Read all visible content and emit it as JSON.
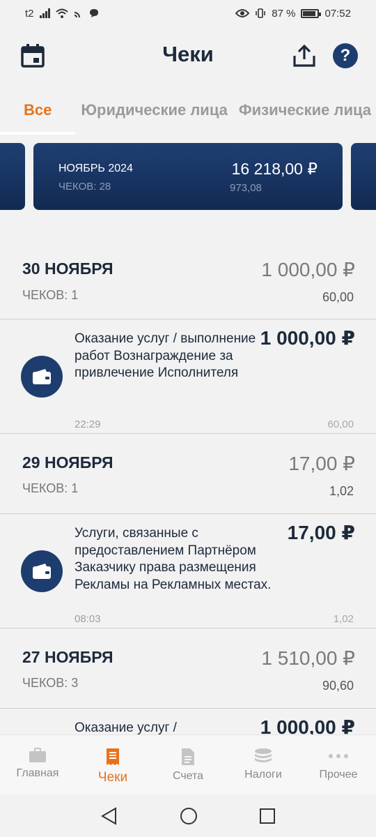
{
  "status_bar": {
    "carrier": "t2",
    "battery": "87 %",
    "time": "07:52"
  },
  "header": {
    "title": "Чеки"
  },
  "tabs": [
    {
      "label": "Все",
      "active": true
    },
    {
      "label": "Юридические лица",
      "active": false
    },
    {
      "label": "Физические лица",
      "active": false
    }
  ],
  "month_card": {
    "month": "НОЯБРЬ 2024",
    "count": "ЧЕКОВ: 28",
    "sum": "16 218,00 ₽",
    "tax": "973,08"
  },
  "days": [
    {
      "date": "30 НОЯБРЯ",
      "count": "ЧЕКОВ: 1",
      "amount": "1 000,00 ₽",
      "tax": "60,00",
      "receipts": [
        {
          "description": "Оказание услуг / выполнение работ Вознаграждение за привлечение Исполнителя",
          "time": "22:29",
          "amount": "1 000,00 ₽",
          "tax": "60,00"
        }
      ]
    },
    {
      "date": "29 НОЯБРЯ",
      "count": "ЧЕКОВ: 1",
      "amount": "17,00 ₽",
      "tax": "1,02",
      "receipts": [
        {
          "description": "Услуги, связанные с предоставлением Партнёром Заказчику права размещения Рекламы на Рекламных местах.",
          "time": "08:03",
          "amount": "17,00 ₽",
          "tax": "1,02"
        }
      ]
    },
    {
      "date": "27 НОЯБРЯ",
      "count": "ЧЕКОВ: 3",
      "amount": "1 510,00 ₽",
      "tax": "90,60",
      "receipts": [
        {
          "description": "Оказание услуг /",
          "time": "",
          "amount": "1 000,00 ₽",
          "tax": ""
        }
      ]
    }
  ],
  "bottom_nav": [
    {
      "label": "Главная",
      "icon": "briefcase-icon",
      "active": false
    },
    {
      "label": "Чеки",
      "icon": "receipt-icon",
      "active": true
    },
    {
      "label": "Счета",
      "icon": "document-icon",
      "active": false
    },
    {
      "label": "Налоги",
      "icon": "coins-icon",
      "active": false
    },
    {
      "label": "Прочее",
      "icon": "more-icon",
      "active": false
    }
  ],
  "colors": {
    "accent": "#e8721c",
    "navy": "#1e3d6f"
  }
}
